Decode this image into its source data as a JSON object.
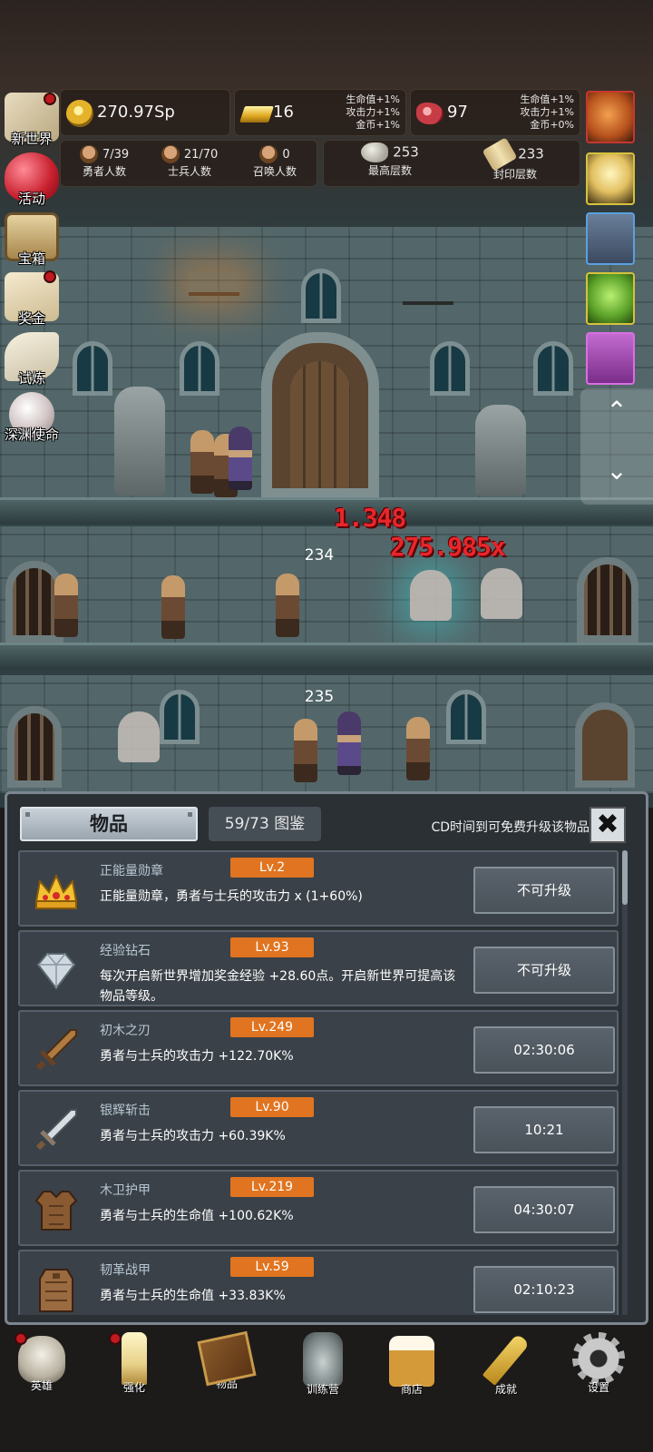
{
  "resources": {
    "gold": "270.97Sp",
    "bars": "16",
    "bars_bonus": [
      "生命值+1%",
      "攻击力+1%",
      "金币+1%"
    ],
    "meat": "97",
    "meat_bonus": [
      "生命值+1%",
      "攻击力+1%",
      "金币+0%"
    ]
  },
  "counts": {
    "heroes": {
      "value": "7/39",
      "label": "勇者人数"
    },
    "soldiers": {
      "value": "21/70",
      "label": "士兵人数"
    },
    "summons": {
      "value": "0",
      "label": "召唤人数"
    },
    "max_floor": {
      "value": "253",
      "label": "最高层数"
    },
    "sealed_floor": {
      "value": "233",
      "label": "封印层数"
    }
  },
  "side_menu": [
    {
      "label": "新世界",
      "icon": "map-icon",
      "dot": true
    },
    {
      "label": "活动",
      "icon": "heart-icon",
      "dot": false
    },
    {
      "label": "宝箱",
      "icon": "chest-icon",
      "dot": false
    },
    {
      "label": "奖金",
      "icon": "envelope-icon",
      "dot": true
    },
    {
      "label": "试炼",
      "icon": "feather-icon",
      "dot": false
    },
    {
      "label": "深渊使命",
      "icon": "orb-icon",
      "dot": false
    }
  ],
  "scene": {
    "floor_numbers": [
      "234",
      "235"
    ],
    "damage_texts": [
      "1.348",
      "275.985x"
    ]
  },
  "panel": {
    "title": "物品",
    "collection": "59/73 图鉴",
    "hint": "CD时间到可免费升级该物品",
    "items": [
      {
        "name": "正能量勋章",
        "level": "Lv.2",
        "desc": "正能量勋章，勇者与士兵的攻击力 x (1+60%)",
        "action": "不可升级",
        "icon": "crown-icon"
      },
      {
        "name": "经验钻石",
        "level": "Lv.93",
        "desc": "每次开启新世界增加奖金经验 +28.60点。开启新世界可提高该物品等级。",
        "action": "不可升级",
        "icon": "diamond-icon"
      },
      {
        "name": "初木之刃",
        "level": "Lv.249",
        "desc": "勇者与士兵的攻击力 +122.70K%",
        "action": "02:30:06",
        "icon": "wooden-sword-icon"
      },
      {
        "name": "银辉斩击",
        "level": "Lv.90",
        "desc": "勇者与士兵的攻击力 +60.39K%",
        "action": "10:21",
        "icon": "silver-sword-icon"
      },
      {
        "name": "木卫护甲",
        "level": "Lv.219",
        "desc": "勇者与士兵的生命值 +100.62K%",
        "action": "04:30:07",
        "icon": "armor-icon"
      },
      {
        "name": "韧革战甲",
        "level": "Lv.59",
        "desc": "勇者与士兵的生命值 +33.83K%",
        "action": "02:10:23",
        "icon": "leather-armor-icon"
      }
    ]
  },
  "nav": [
    {
      "label": "英雄",
      "icon": "skull-icon",
      "dot": true
    },
    {
      "label": "强化",
      "icon": "candle-icon",
      "dot": true
    },
    {
      "label": "物品",
      "icon": "book-icon",
      "dot": false
    },
    {
      "label": "训练营",
      "icon": "lantern-icon",
      "dot": false
    },
    {
      "label": "商店",
      "icon": "beer-mug-icon",
      "dot": false
    },
    {
      "label": "成就",
      "icon": "key-icon",
      "dot": false
    },
    {
      "label": "设置",
      "icon": "gear-icon",
      "dot": false
    }
  ]
}
